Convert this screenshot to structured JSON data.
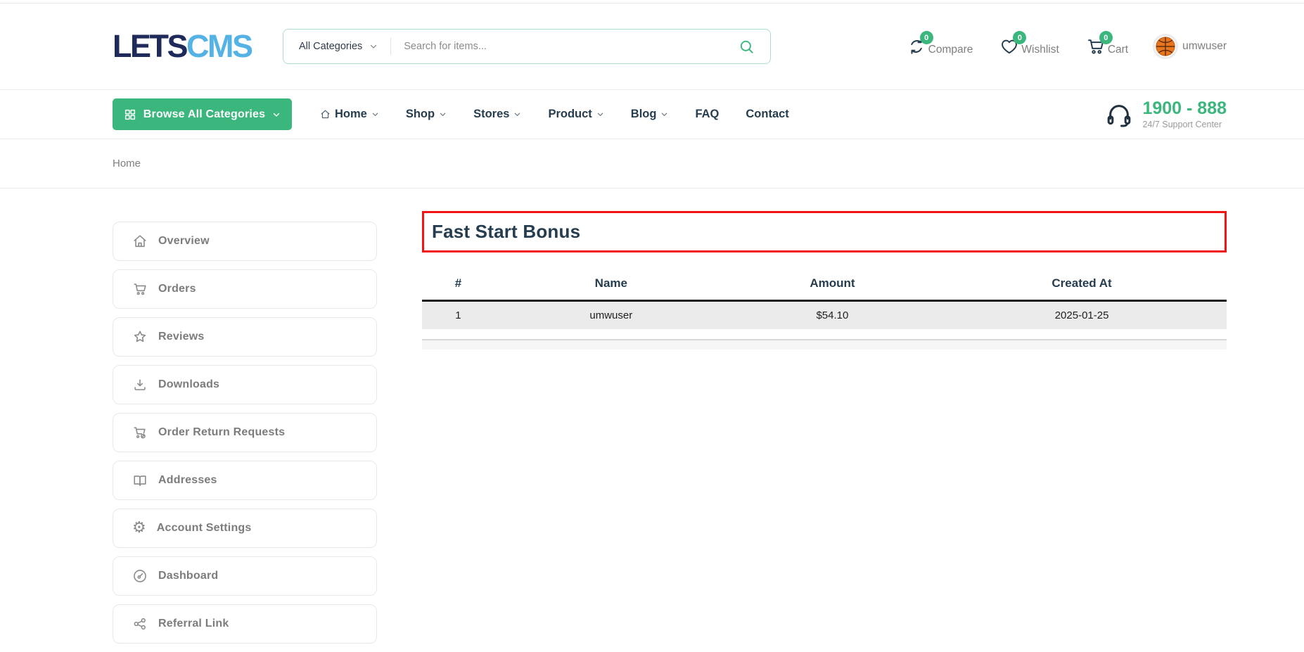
{
  "header": {
    "logo_part1": "LETS",
    "logo_part2": "CMS",
    "search": {
      "category": "All Categories",
      "placeholder": "Search for items..."
    },
    "actions": [
      {
        "icon": "compare-icon",
        "label": "Compare",
        "count": "0"
      },
      {
        "icon": "wishlist-icon",
        "label": "Wishlist",
        "count": "0"
      },
      {
        "icon": "cart-icon",
        "label": "Cart",
        "count": "0"
      }
    ],
    "user": {
      "name": "umwuser"
    }
  },
  "nav": {
    "browse_button_label": "Browse All Categories",
    "links": [
      {
        "label": "Home",
        "has_dropdown": true
      },
      {
        "label": "Shop",
        "has_dropdown": true
      },
      {
        "label": "Stores",
        "has_dropdown": true
      },
      {
        "label": "Product",
        "has_dropdown": true
      },
      {
        "label": "Blog",
        "has_dropdown": true
      },
      {
        "label": "FAQ",
        "has_dropdown": false
      },
      {
        "label": "Contact",
        "has_dropdown": false
      }
    ],
    "support": {
      "phone": "1900 - 888",
      "caption": "24/7 Support Center"
    }
  },
  "breadcrumb": [
    "Home"
  ],
  "sidebar": [
    {
      "icon": "home-icon",
      "label": "Overview"
    },
    {
      "icon": "cart-icon",
      "label": "Orders"
    },
    {
      "icon": "star-icon",
      "label": "Reviews"
    },
    {
      "icon": "download-icon",
      "label": "Downloads"
    },
    {
      "icon": "cart-return-icon",
      "label": "Order Return Requests"
    },
    {
      "icon": "address-book-icon",
      "label": "Addresses"
    },
    {
      "icon": "gear-icon",
      "label": "Account Settings"
    },
    {
      "icon": "dashboard-icon",
      "label": "Dashboard"
    },
    {
      "icon": "share-icon",
      "label": "Referral Link"
    }
  ],
  "main": {
    "title": "Fast Start Bonus",
    "table": {
      "columns": [
        "#",
        "Name",
        "Amount",
        "Created At"
      ],
      "rows": [
        [
          "1",
          "umwuser",
          "$54.10",
          "2025-01-25"
        ]
      ]
    }
  },
  "colors": {
    "accent_green": "#3BB77E",
    "navy_text": "#253D4E",
    "logo_navy": "#1E2A5A",
    "logo_blue": "#55B2E4",
    "highlight_red": "#F01414",
    "muted_gray": "#7E7E7E"
  }
}
